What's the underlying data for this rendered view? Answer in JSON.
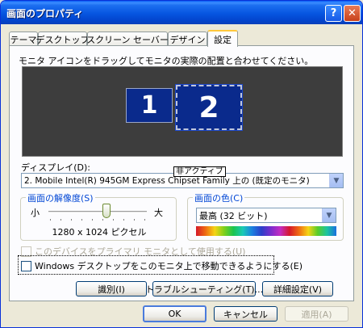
{
  "window": {
    "title": "画面のプロパティ",
    "help_glyph": "?",
    "close_glyph": "✕"
  },
  "tabs": [
    {
      "label": "テーマ"
    },
    {
      "label": "デスクトップ"
    },
    {
      "label": "スクリーン セーバー"
    },
    {
      "label": "デザイン"
    },
    {
      "label": "設定",
      "active": true
    }
  ],
  "settings": {
    "instruction": "モニタ アイコンをドラッグしてモニタの実際の配置と合わせてください。",
    "monitor1_label": "1",
    "monitor2_label": "2",
    "inactive_label": "非アクティブ",
    "display_label": "ディスプレイ(D):",
    "display_value": "2. Mobile Intel(R) 945GM Express Chipset Family 上の (既定のモニタ)",
    "resolution": {
      "legend": "画面の解像度(S)",
      "min_label": "小",
      "max_label": "大",
      "value": "1280 x 1024 ピクセル"
    },
    "color": {
      "legend": "画面の色(C)",
      "value": "最高 (32 ビット)"
    },
    "primary_checkbox_label": "このデバイスをプライマリ モニタとして使用する(U)",
    "extend_checkbox_label": "Windows デスクトップをこのモニタ上で移動できるようにする(E)",
    "identify_button": "識別(I)",
    "troubleshoot_button": "トラブルシューティング(T)...",
    "advanced_button": "詳細設定(V)"
  },
  "footer": {
    "ok_button": "OK",
    "cancel_button": "キャンセル",
    "apply_button": "適用(A)"
  },
  "colors": {
    "title_blue": "#0a5ef6",
    "tab_highlight": "#ffc83c",
    "monitor_blue": "#0a2a8c"
  }
}
